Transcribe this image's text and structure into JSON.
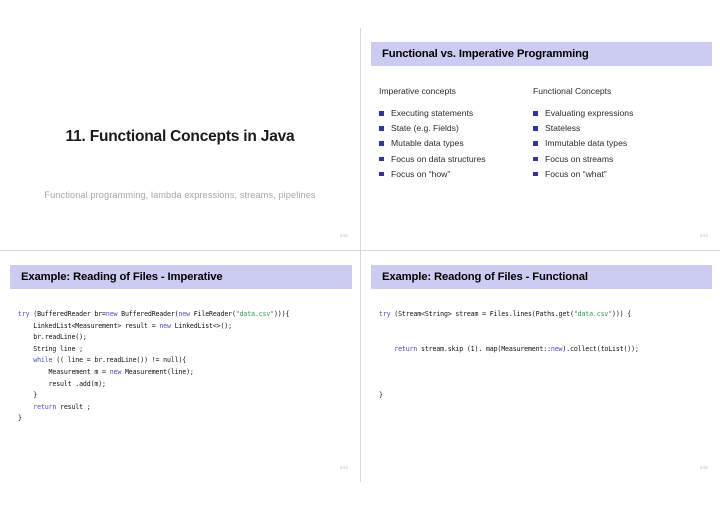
{
  "document": {
    "kind": "lecture-slide-handout",
    "slide_count": 4
  },
  "slides": {
    "title_page": {
      "title": "11. Functional Concepts in Java",
      "subtitle": "Functional programming, lambda expressions, streams, pipelines",
      "page_number": "342"
    },
    "concepts": {
      "header": "Functional vs. Imperative Programming",
      "page_number": "343",
      "columns": [
        {
          "heading": "Imperative concepts",
          "items": [
            "Executing statements",
            "State (e.g. Fields)",
            "Mutable data types",
            "Focus on data structures",
            "Focus on “how”"
          ]
        },
        {
          "heading": "Functional Concepts",
          "items": [
            "Evaluating expressions",
            "Stateless",
            "Immutable data types",
            "Focus on streams",
            "Focus on “what”"
          ]
        }
      ]
    },
    "imperative_example": {
      "header": "Example: Reading of Files - Imperative",
      "page_number": "344",
      "code_lines": [
        [
          {
            "t": "try",
            "c": "kw"
          },
          {
            "t": " (BufferedReader br=",
            "c": ""
          },
          {
            "t": "new",
            "c": "kw"
          },
          {
            "t": " BufferedReader(",
            "c": ""
          },
          {
            "t": "new",
            "c": "kw"
          },
          {
            "t": " FileReader(",
            "c": ""
          },
          {
            "t": "\"data.csv\"",
            "c": "str"
          },
          {
            "t": "))){",
            "c": ""
          }
        ],
        [
          {
            "t": "    LinkedList<Measurement> result = ",
            "c": ""
          },
          {
            "t": "new",
            "c": "kw"
          },
          {
            "t": " LinkedList<>();",
            "c": ""
          }
        ],
        [
          {
            "t": "    br.readLine();",
            "c": ""
          }
        ],
        [
          {
            "t": "    String line ;",
            "c": ""
          }
        ],
        [
          {
            "t": "    ",
            "c": ""
          },
          {
            "t": "while",
            "c": "kw"
          },
          {
            "t": " (( line = br.readLine()) != null){",
            "c": ""
          }
        ],
        [
          {
            "t": "        Measurement m = ",
            "c": ""
          },
          {
            "t": "new",
            "c": "kw"
          },
          {
            "t": " Measurement(line);",
            "c": ""
          }
        ],
        [
          {
            "t": "        result .add(m);",
            "c": ""
          }
        ],
        [
          {
            "t": "    }",
            "c": ""
          }
        ],
        [
          {
            "t": "    ",
            "c": ""
          },
          {
            "t": "return",
            "c": "kw"
          },
          {
            "t": " result ;",
            "c": ""
          }
        ],
        [
          {
            "t": "}",
            "c": ""
          }
        ]
      ]
    },
    "functional_example": {
      "header": "Example: Readong of Files - Functional",
      "page_number": "345",
      "code_lines": [
        [
          {
            "t": "try",
            "c": "kw"
          },
          {
            "t": " (Stream<String> stream = Files.lines(Paths.get(",
            "c": ""
          },
          {
            "t": "\"data.csv\"",
            "c": "str"
          },
          {
            "t": "))) {",
            "c": ""
          }
        ],
        [
          {
            "t": "",
            "c": ""
          }
        ],
        [
          {
            "t": "",
            "c": ""
          }
        ],
        [
          {
            "t": "    ",
            "c": ""
          },
          {
            "t": "return",
            "c": "kw"
          },
          {
            "t": " stream.skip (1). map(Measurement::",
            "c": ""
          },
          {
            "t": "new",
            "c": "kw"
          },
          {
            "t": ").collect(toList());",
            "c": ""
          }
        ],
        [
          {
            "t": "",
            "c": ""
          }
        ],
        [
          {
            "t": "",
            "c": ""
          }
        ],
        [
          {
            "t": "",
            "c": ""
          }
        ],
        [
          {
            "t": "}",
            "c": ""
          }
        ]
      ]
    }
  },
  "colors": {
    "header_bar": "#ccccf2",
    "bullet_square": "#3333a8",
    "keyword": "#5050c8",
    "string_literal": "#2e9e4f",
    "subtitle_grey": "#a6a6a6",
    "page_number_grey": "#bfbfbf"
  }
}
